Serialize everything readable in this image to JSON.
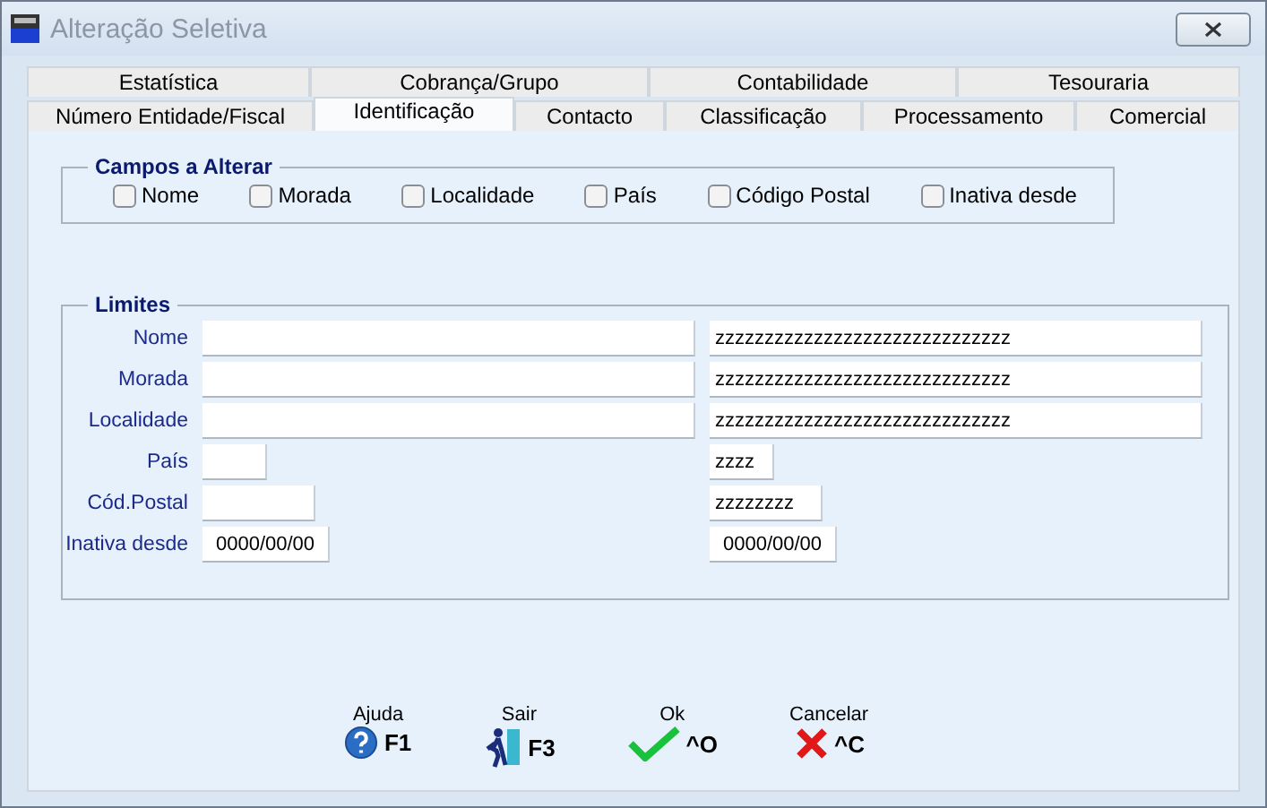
{
  "window": {
    "title": "Alteração Seletiva"
  },
  "tab_rows": [
    [
      {
        "label": "Estatística",
        "selected": false
      },
      {
        "label": "Cobrança/Grupo",
        "selected": false
      },
      {
        "label": "Contabilidade",
        "selected": false
      },
      {
        "label": "Tesouraria",
        "selected": false
      }
    ],
    [
      {
        "label": "Número Entidade/Fiscal",
        "selected": false
      },
      {
        "label": "Identificação",
        "selected": true
      },
      {
        "label": "Contacto",
        "selected": false
      },
      {
        "label": "Classificação",
        "selected": false
      },
      {
        "label": "Processamento",
        "selected": false
      },
      {
        "label": "Comercial",
        "selected": false
      }
    ]
  ],
  "campos": {
    "title": "Campos a Alterar",
    "options": [
      {
        "label": "Nome",
        "checked": false
      },
      {
        "label": "Morada",
        "checked": false
      },
      {
        "label": "Localidade",
        "checked": false
      },
      {
        "label": "País",
        "checked": false
      },
      {
        "label": "Código Postal",
        "checked": false
      },
      {
        "label": "Inativa desde",
        "checked": false
      }
    ]
  },
  "limites": {
    "title": "Limites",
    "rows": [
      {
        "label": "Nome",
        "to": "zzzzzzzzzzzzzzzzzzzzzzzzzzzzzz"
      },
      {
        "label": "Morada",
        "to": "zzzzzzzzzzzzzzzzzzzzzzzzzzzzzz"
      },
      {
        "label": "Localidade",
        "to": "zzzzzzzzzzzzzzzzzzzzzzzzzzzzzz"
      },
      {
        "label": "País",
        "to": "zzzz"
      },
      {
        "label": "Cód.Postal",
        "to": "zzzzzzzz"
      },
      {
        "label": "Inativa desde",
        "from": "0000/00/00",
        "to": "0000/00/00"
      }
    ]
  },
  "buttons": [
    {
      "kind": "help",
      "label": "Ajuda",
      "key": "F1"
    },
    {
      "kind": "exit",
      "label": "Sair",
      "key": "F3"
    },
    {
      "kind": "ok",
      "label": "Ok",
      "key": "^O"
    },
    {
      "kind": "cancel",
      "label": "Cancelar",
      "key": "^C"
    }
  ]
}
